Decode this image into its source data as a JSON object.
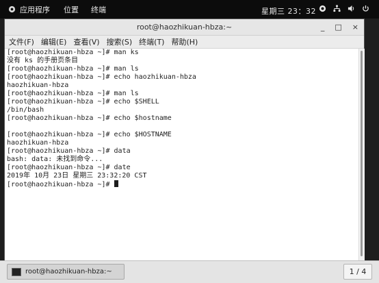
{
  "topbar": {
    "applications": "应用程序",
    "places": "位置",
    "terminal_menu": "终端",
    "clock": "星期三 23：32"
  },
  "window": {
    "title": "root@haozhikuan-hbza:~",
    "buttons": {
      "minimize": "_",
      "maximize": "□",
      "close": "×"
    }
  },
  "menubar": {
    "items": [
      "文件(F)",
      "编辑(E)",
      "查看(V)",
      "搜索(S)",
      "终端(T)",
      "帮助(H)"
    ]
  },
  "terminal": {
    "lines": [
      "[root@haozhikuan-hbza ~]# man ks",
      "没有 ks 的手册页条目",
      "[root@haozhikuan-hbza ~]# man ls",
      "[root@haozhikuan-hbza ~]# echo haozhikuan-hbza",
      "haozhikuan-hbza",
      "[root@haozhikuan-hbza ~]# man ls",
      "[root@haozhikuan-hbza ~]# echo $SHELL",
      "/bin/bash",
      "[root@haozhikuan-hbza ~]# echo $hostname",
      "",
      "[root@haozhikuan-hbza ~]# echo $HOSTNAME",
      "haozhikuan-hbza",
      "[root@haozhikuan-hbza ~]# data",
      "bash: data: 未找到命令...",
      "[root@haozhikuan-hbza ~]# date",
      "2019年 10月 23日 星期三 23:32:20 CST"
    ],
    "prompt": "[root@haozhikuan-hbza ~]# "
  },
  "taskbar": {
    "task_label": "root@haozhikuan-hbza:~",
    "workspace": "1 / 4"
  }
}
